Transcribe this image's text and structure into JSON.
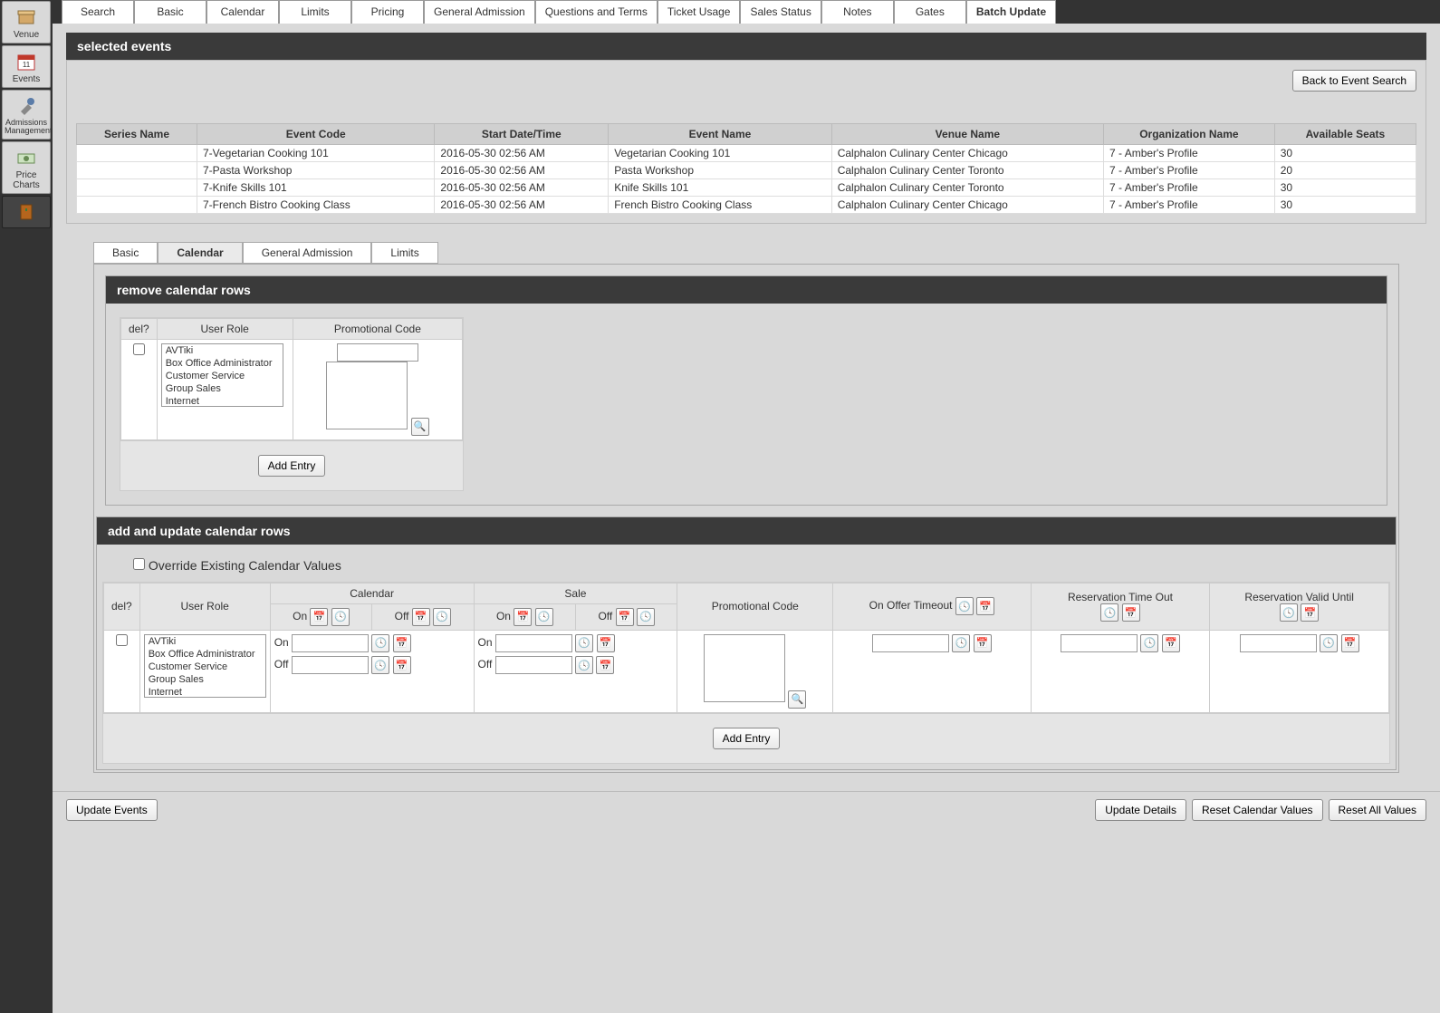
{
  "sidebar": {
    "items": [
      {
        "label": "Venue"
      },
      {
        "label": "Events"
      },
      {
        "label": "Admissions Management"
      },
      {
        "label": "Price Charts"
      }
    ]
  },
  "top_tabs": [
    "Search",
    "Basic",
    "Calendar",
    "Limits",
    "Pricing",
    "General Admission",
    "Questions and Terms",
    "Ticket Usage",
    "Sales Status",
    "Notes",
    "Gates",
    "Batch Update"
  ],
  "active_top_tab": "Batch Update",
  "selected_events": {
    "title": "selected events",
    "back_btn": "Back to Event Search",
    "headers": [
      "Series Name",
      "Event Code",
      "Start Date/Time",
      "Event Name",
      "Venue Name",
      "Organization Name",
      "Available Seats"
    ],
    "rows": [
      {
        "series": "",
        "code": "7-Vegetarian Cooking 101",
        "start": "2016-05-30 02:56 AM",
        "event": "Vegetarian Cooking 101",
        "venue": "Calphalon Culinary Center Chicago",
        "org": "7 - Amber's Profile",
        "seats": "30"
      },
      {
        "series": "",
        "code": "7-Pasta Workshop",
        "start": "2016-05-30 02:56 AM",
        "event": "Pasta Workshop",
        "venue": "Calphalon Culinary Center Toronto",
        "org": "7 - Amber's Profile",
        "seats": "20"
      },
      {
        "series": "",
        "code": "7-Knife Skills 101",
        "start": "2016-05-30 02:56 AM",
        "event": "Knife Skills 101",
        "venue": "Calphalon Culinary Center Toronto",
        "org": "7 - Amber's Profile",
        "seats": "30"
      },
      {
        "series": "",
        "code": "7-French Bistro Cooking Class",
        "start": "2016-05-30 02:56 AM",
        "event": "French Bistro Cooking Class",
        "venue": "Calphalon Culinary Center Chicago",
        "org": "7 - Amber's Profile",
        "seats": "30"
      }
    ]
  },
  "sub_tabs": [
    "Basic",
    "Calendar",
    "General Admission",
    "Limits"
  ],
  "active_sub_tab": "Calendar",
  "remove_section": {
    "title": "remove calendar rows",
    "headers": {
      "del": "del?",
      "role": "User Role",
      "promo": "Promotional Code"
    },
    "roles": [
      "AVTiki",
      "Box Office Administrator",
      "Customer Service",
      "Group Sales",
      "Internet"
    ],
    "add_btn": "Add Entry"
  },
  "add_section": {
    "title": "add and update calendar rows",
    "override_label": "Override Existing Calendar Values",
    "headers": {
      "del": "del?",
      "role": "User Role",
      "calendar": "Calendar",
      "sale": "Sale",
      "promo": "Promotional Code",
      "offer": "On Offer Timeout",
      "res_timeout": "Reservation Time Out",
      "res_valid": "Reservation Valid Until",
      "on": "On",
      "off": "Off"
    },
    "roles": [
      "AVTiki",
      "Box Office Administrator",
      "Customer Service",
      "Group Sales",
      "Internet"
    ],
    "add_btn": "Add Entry"
  },
  "footer": {
    "update_events": "Update Events",
    "update_details": "Update Details",
    "reset_calendar": "Reset Calendar Values",
    "reset_all": "Reset All Values"
  }
}
